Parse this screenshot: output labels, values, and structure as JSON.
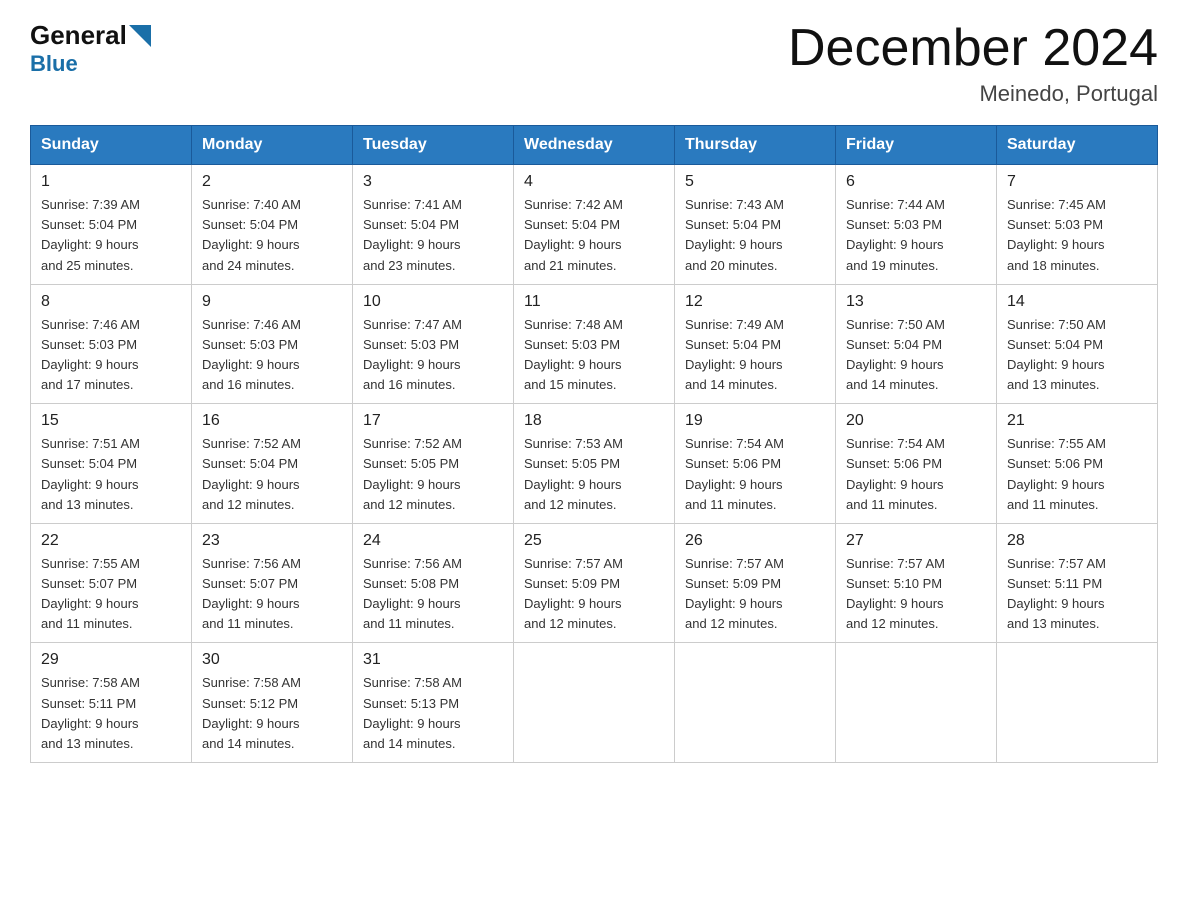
{
  "logo": {
    "general": "General",
    "blue": "Blue",
    "aria": "GeneralBlue logo"
  },
  "header": {
    "month": "December 2024",
    "location": "Meinedo, Portugal"
  },
  "days_header": [
    "Sunday",
    "Monday",
    "Tuesday",
    "Wednesday",
    "Thursday",
    "Friday",
    "Saturday"
  ],
  "weeks": [
    [
      {
        "day": "1",
        "sunrise": "7:39 AM",
        "sunset": "5:04 PM",
        "daylight": "9 hours and 25 minutes."
      },
      {
        "day": "2",
        "sunrise": "7:40 AM",
        "sunset": "5:04 PM",
        "daylight": "9 hours and 24 minutes."
      },
      {
        "day": "3",
        "sunrise": "7:41 AM",
        "sunset": "5:04 PM",
        "daylight": "9 hours and 23 minutes."
      },
      {
        "day": "4",
        "sunrise": "7:42 AM",
        "sunset": "5:04 PM",
        "daylight": "9 hours and 21 minutes."
      },
      {
        "day": "5",
        "sunrise": "7:43 AM",
        "sunset": "5:04 PM",
        "daylight": "9 hours and 20 minutes."
      },
      {
        "day": "6",
        "sunrise": "7:44 AM",
        "sunset": "5:03 PM",
        "daylight": "9 hours and 19 minutes."
      },
      {
        "day": "7",
        "sunrise": "7:45 AM",
        "sunset": "5:03 PM",
        "daylight": "9 hours and 18 minutes."
      }
    ],
    [
      {
        "day": "8",
        "sunrise": "7:46 AM",
        "sunset": "5:03 PM",
        "daylight": "9 hours and 17 minutes."
      },
      {
        "day": "9",
        "sunrise": "7:46 AM",
        "sunset": "5:03 PM",
        "daylight": "9 hours and 16 minutes."
      },
      {
        "day": "10",
        "sunrise": "7:47 AM",
        "sunset": "5:03 PM",
        "daylight": "9 hours and 16 minutes."
      },
      {
        "day": "11",
        "sunrise": "7:48 AM",
        "sunset": "5:03 PM",
        "daylight": "9 hours and 15 minutes."
      },
      {
        "day": "12",
        "sunrise": "7:49 AM",
        "sunset": "5:04 PM",
        "daylight": "9 hours and 14 minutes."
      },
      {
        "day": "13",
        "sunrise": "7:50 AM",
        "sunset": "5:04 PM",
        "daylight": "9 hours and 14 minutes."
      },
      {
        "day": "14",
        "sunrise": "7:50 AM",
        "sunset": "5:04 PM",
        "daylight": "9 hours and 13 minutes."
      }
    ],
    [
      {
        "day": "15",
        "sunrise": "7:51 AM",
        "sunset": "5:04 PM",
        "daylight": "9 hours and 13 minutes."
      },
      {
        "day": "16",
        "sunrise": "7:52 AM",
        "sunset": "5:04 PM",
        "daylight": "9 hours and 12 minutes."
      },
      {
        "day": "17",
        "sunrise": "7:52 AM",
        "sunset": "5:05 PM",
        "daylight": "9 hours and 12 minutes."
      },
      {
        "day": "18",
        "sunrise": "7:53 AM",
        "sunset": "5:05 PM",
        "daylight": "9 hours and 12 minutes."
      },
      {
        "day": "19",
        "sunrise": "7:54 AM",
        "sunset": "5:06 PM",
        "daylight": "9 hours and 11 minutes."
      },
      {
        "day": "20",
        "sunrise": "7:54 AM",
        "sunset": "5:06 PM",
        "daylight": "9 hours and 11 minutes."
      },
      {
        "day": "21",
        "sunrise": "7:55 AM",
        "sunset": "5:06 PM",
        "daylight": "9 hours and 11 minutes."
      }
    ],
    [
      {
        "day": "22",
        "sunrise": "7:55 AM",
        "sunset": "5:07 PM",
        "daylight": "9 hours and 11 minutes."
      },
      {
        "day": "23",
        "sunrise": "7:56 AM",
        "sunset": "5:07 PM",
        "daylight": "9 hours and 11 minutes."
      },
      {
        "day": "24",
        "sunrise": "7:56 AM",
        "sunset": "5:08 PM",
        "daylight": "9 hours and 11 minutes."
      },
      {
        "day": "25",
        "sunrise": "7:57 AM",
        "sunset": "5:09 PM",
        "daylight": "9 hours and 12 minutes."
      },
      {
        "day": "26",
        "sunrise": "7:57 AM",
        "sunset": "5:09 PM",
        "daylight": "9 hours and 12 minutes."
      },
      {
        "day": "27",
        "sunrise": "7:57 AM",
        "sunset": "5:10 PM",
        "daylight": "9 hours and 12 minutes."
      },
      {
        "day": "28",
        "sunrise": "7:57 AM",
        "sunset": "5:11 PM",
        "daylight": "9 hours and 13 minutes."
      }
    ],
    [
      {
        "day": "29",
        "sunrise": "7:58 AM",
        "sunset": "5:11 PM",
        "daylight": "9 hours and 13 minutes."
      },
      {
        "day": "30",
        "sunrise": "7:58 AM",
        "sunset": "5:12 PM",
        "daylight": "9 hours and 14 minutes."
      },
      {
        "day": "31",
        "sunrise": "7:58 AM",
        "sunset": "5:13 PM",
        "daylight": "9 hours and 14 minutes."
      },
      null,
      null,
      null,
      null
    ]
  ],
  "labels": {
    "sunrise": "Sunrise:",
    "sunset": "Sunset:",
    "daylight": "Daylight:"
  }
}
